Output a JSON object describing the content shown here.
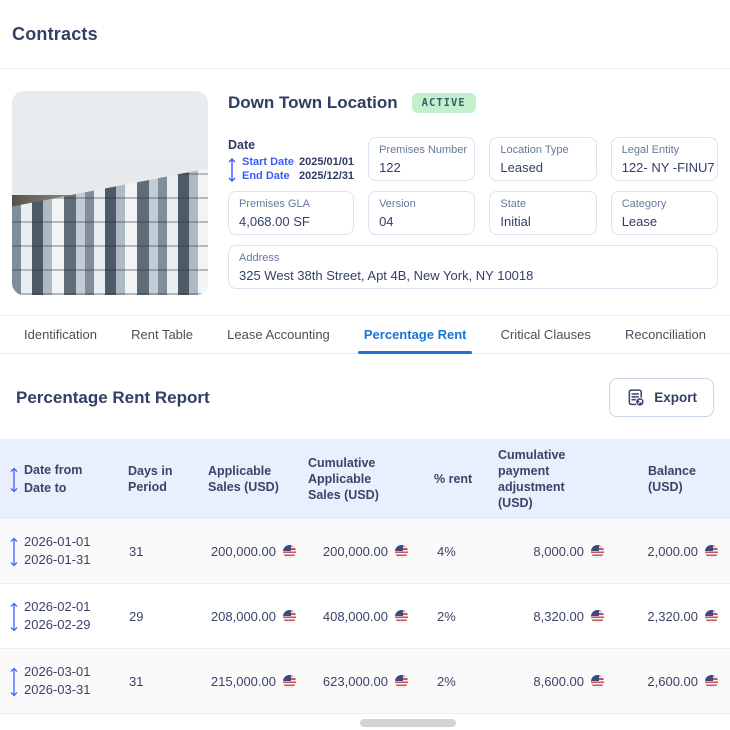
{
  "page": {
    "title": "Contracts"
  },
  "contract": {
    "name": "Down Town Location",
    "status": "ACTIVE",
    "date": {
      "label": "Date",
      "start_label": "Start Date",
      "start_value": "2025/01/01",
      "end_label": "End Date",
      "end_value": "2025/12/31"
    },
    "fields": [
      {
        "label": "Premises Number",
        "value": "122"
      },
      {
        "label": "Location Type",
        "value": "Leased"
      },
      {
        "label": "Legal Entity",
        "value": "122- NY -FINU7"
      },
      {
        "label": "Premises GLA",
        "value": "4,068.00 SF"
      },
      {
        "label": "Version",
        "value": "04"
      },
      {
        "label": "State",
        "value": "Initial"
      },
      {
        "label": "Category",
        "value": "Lease"
      }
    ],
    "address": {
      "label": "Address",
      "value": "325 West 38th Street, Apt 4B, New York, NY 10018"
    }
  },
  "tabs": [
    {
      "label": "Identification",
      "active": false
    },
    {
      "label": "Rent Table",
      "active": false
    },
    {
      "label": "Lease Accounting",
      "active": false
    },
    {
      "label": "Percentage Rent",
      "active": true
    },
    {
      "label": "Critical Clauses",
      "active": false
    },
    {
      "label": "Reconciliation",
      "active": false
    }
  ],
  "report": {
    "title": "Percentage Rent Report",
    "export_label": "Export"
  },
  "table": {
    "columns": [
      {
        "label": "Date from",
        "label2": "Date to"
      },
      {
        "label": "Days in Period"
      },
      {
        "label": "Applicable Sales (USD)"
      },
      {
        "label": "Cumulative Applicable Sales (USD)"
      },
      {
        "label": "% rent"
      },
      {
        "label": "Cumulative payment adjustment (USD)"
      },
      {
        "label": "Balance (USD)"
      }
    ],
    "currency_icon": "us-flag",
    "rows": [
      {
        "date_from": "2026-01-01",
        "date_to": "2026-01-31",
        "days": "31",
        "applicable_sales": "200,000.00",
        "cumulative_sales": "200,000.00",
        "percent_rent": "4%",
        "cumulative_payment": "8,000.00",
        "balance": "2,000.00"
      },
      {
        "date_from": "2026-02-01",
        "date_to": "2026-02-29",
        "days": "29",
        "applicable_sales": "208,000.00",
        "cumulative_sales": "408,000.00",
        "percent_rent": "2%",
        "cumulative_payment": "8,320.00",
        "balance": "2,320.00"
      },
      {
        "date_from": "2026-03-01",
        "date_to": "2026-03-31",
        "days": "31",
        "applicable_sales": "215,000.00",
        "cumulative_sales": "623,000.00",
        "percent_rent": "2%",
        "cumulative_payment": "8,600.00",
        "balance": "2,600.00"
      }
    ]
  },
  "colors": {
    "accent_blue": "#1b74d4",
    "link_blue": "#3b5bfd",
    "badge_green_bg": "#c2f0cf",
    "table_header_bg": "#e9effc",
    "text_navy": "#333f63"
  }
}
